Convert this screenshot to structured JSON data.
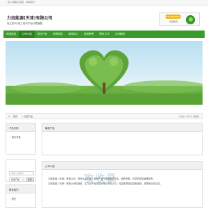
{
  "topbar": {
    "links": [
      "加入收藏",
      "设为首页",
      "联系我们"
    ]
  },
  "header": {
    "company_name": "力冠能源(天津)有限公司",
    "slogan": "电工电气/电工电气产品代理销售",
    "badge_label": "Free Member",
    "badge_note": "普通会员"
  },
  "nav": {
    "items": [
      "网站首页",
      "公司介绍",
      "供应产品",
      "采购信息",
      "新闻中心",
      "资质荣誉",
      "联系方式",
      "公司相册"
    ],
    "active_index": 1
  },
  "breadcrumb": {
    "home": "首页",
    "separator": ">",
    "current": "供应产品",
    "date": "今天是 2月6日 星期四"
  },
  "sidebar": {
    "categories_title": "产品分类",
    "categories": [
      "暂无分类"
    ],
    "search_placeholder": "请输入关键字",
    "search_select_value": "供应产品",
    "search_button": "搜索",
    "contact_title": "联系我们",
    "contact_items": [
      "暂无"
    ],
    "album_title": "相册",
    "album_items": [
      "暂无"
    ]
  },
  "main": {
    "products_title": "最新产品",
    "intro_title": "公司介绍",
    "intro_lines": [
      "力冠能源（天津）有限公司，是专业从事电工电气产品代理销售的企业，拥有完整、科学的质量管理体系",
      "力冠能源（天津）有限公司的诚信、实力和产品质量获得业界的认可。欢迎各界朋友莅临参观、指导和业务洽谈。"
    ],
    "watermark": "攻收录"
  },
  "colors": {
    "nav_green": "#3a9b2a",
    "nav_active": "#2f7f22",
    "badge_yellow": "#f3b300"
  },
  "icons": {
    "home": "home-icon",
    "badge": "member-badge-icon"
  }
}
